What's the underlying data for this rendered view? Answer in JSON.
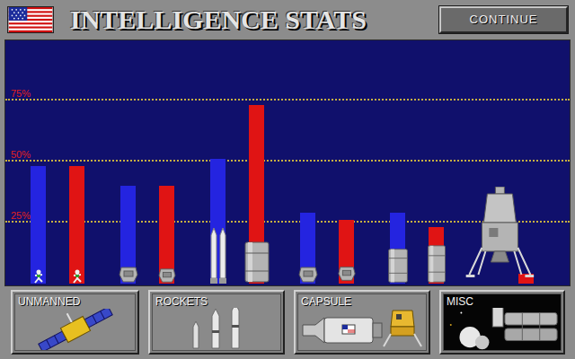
{
  "header": {
    "title": "INTELLIGENCE STATS",
    "continue_button": "CONTINUE"
  },
  "chart": {
    "ticks": [
      "75%",
      "50%",
      "25%"
    ],
    "series": [
      {
        "color": "#2424e0",
        "values": [
          48,
          40,
          51,
          29,
          29,
          0
        ]
      },
      {
        "color": "#e01414",
        "values": [
          48,
          40,
          73,
          26,
          23,
          4
        ]
      }
    ]
  },
  "categories": [
    {
      "label": "UNMANNED"
    },
    {
      "label": "ROCKETS"
    },
    {
      "label": "CAPSULE"
    },
    {
      "label": "MISC"
    }
  ]
}
